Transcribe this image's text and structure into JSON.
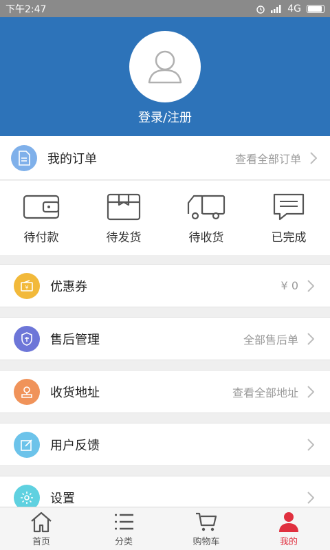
{
  "status_bar": {
    "time": "下午2:47",
    "network": "4G"
  },
  "header": {
    "login_label": "登录/注册"
  },
  "orders": {
    "title": "我的订单",
    "view_all": "查看全部订单",
    "statuses": [
      {
        "label": "待付款",
        "icon": "wallet-icon"
      },
      {
        "label": "待发货",
        "icon": "package-icon"
      },
      {
        "label": "待收货",
        "icon": "truck-icon"
      },
      {
        "label": "已完成",
        "icon": "message-icon"
      }
    ]
  },
  "menu": [
    {
      "title": "优惠券",
      "sub": "¥ 0",
      "icon": "coupon-icon",
      "color": "#f2b93a"
    },
    {
      "title": "售后管理",
      "sub": "全部售后单",
      "icon": "shield-icon",
      "color": "#6d76d8"
    },
    {
      "title": "收货地址",
      "sub": "查看全部地址",
      "icon": "location-icon",
      "color": "#f0935a"
    },
    {
      "title": "用户反馈",
      "sub": "",
      "icon": "edit-icon",
      "color": "#6cc3ea"
    },
    {
      "title": "设置",
      "sub": "",
      "icon": "settings-icon",
      "color": "#5fd1e0"
    }
  ],
  "bottom_nav": [
    {
      "label": "首页",
      "icon": "home-icon"
    },
    {
      "label": "分类",
      "icon": "list-icon"
    },
    {
      "label": "购物车",
      "icon": "cart-icon"
    },
    {
      "label": "我的",
      "icon": "profile-icon",
      "active": true
    }
  ],
  "colors": {
    "header_bg": "#2d73b9",
    "active": "#e0303f",
    "order_icon": "#7fb0ea"
  }
}
